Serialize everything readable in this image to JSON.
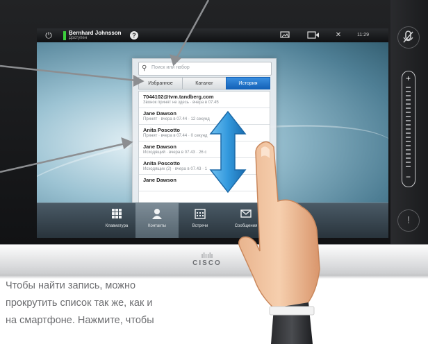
{
  "topbar": {
    "user_name": "Bernhard Johnsson",
    "user_status": "Доступен",
    "help_label": "?",
    "time": "11:29",
    "icons": [
      "power-icon",
      "presentation-icon",
      "camera-icon",
      "tools-icon"
    ]
  },
  "search": {
    "placeholder": "Поиск или набор"
  },
  "tabs": [
    {
      "label": "Избранное",
      "active": false
    },
    {
      "label": "Каталог",
      "active": false
    },
    {
      "label": "История",
      "active": true
    }
  ],
  "contacts": [
    {
      "name": "7044102@tvm.tandberg.com",
      "detail": "Звонок принят не здесь · вчера в 07.45"
    },
    {
      "name": "Jane Dawson",
      "detail": "Принят · вчера в 07.44 · 12 секунд"
    },
    {
      "name": "Anita Poscotto",
      "detail": "Принят · вчера в 07.44 · 0 секунд"
    },
    {
      "name": "Jane Dawson",
      "detail": "Исходящий · вчера в 07.43 · 26 с"
    },
    {
      "name": "Anita Poscotto",
      "detail": "Исходящих (2) · вчера в 07.43 · 1"
    },
    {
      "name": "Jane Dawson",
      "detail": ""
    }
  ],
  "toolbar": [
    {
      "label": "Клавиатура",
      "icon": "keypad-icon",
      "active": false
    },
    {
      "label": "Контакты",
      "icon": "contacts-icon",
      "active": true
    },
    {
      "label": "Встречи",
      "icon": "calendar-icon",
      "active": false
    },
    {
      "label": "Сообщения",
      "icon": "messages-icon",
      "active": false
    }
  ],
  "device": {
    "brand_mark": "ılıılı",
    "brand": "CISCO"
  },
  "right_panel": {
    "volume_plus": "+",
    "volume_minus": "−",
    "alert": "!"
  },
  "caption": {
    "line1": "Чтобы найти запись, можно",
    "line2": "прокрутить список так же, как и",
    "line3": "на смартфоне. Нажмите, чтобы"
  },
  "colors": {
    "accent": "#1f74cc",
    "scroll_arrow": "#3399dd",
    "status_ok": "#3ccf3c"
  }
}
